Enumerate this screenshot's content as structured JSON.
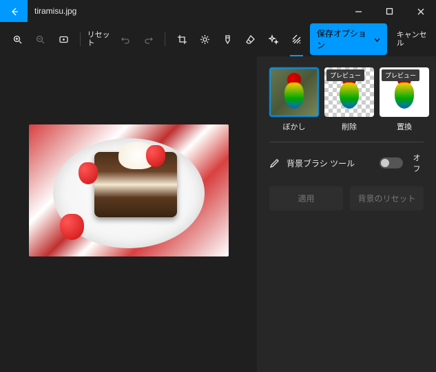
{
  "title": "tiramisu.jpg",
  "toolbar": {
    "reset": "リセット",
    "save_options": "保存オプション",
    "cancel": "キャンセル"
  },
  "panel": {
    "options": [
      {
        "label": "ぼかし",
        "preview_badge": null
      },
      {
        "label": "削除",
        "preview_badge": "プレビュー"
      },
      {
        "label": "置換",
        "preview_badge": "プレビュー"
      }
    ],
    "brush_tool": "背景ブラシ ツール",
    "toggle_state": "オフ",
    "apply": "適用",
    "reset_bg": "背景のリセット"
  }
}
